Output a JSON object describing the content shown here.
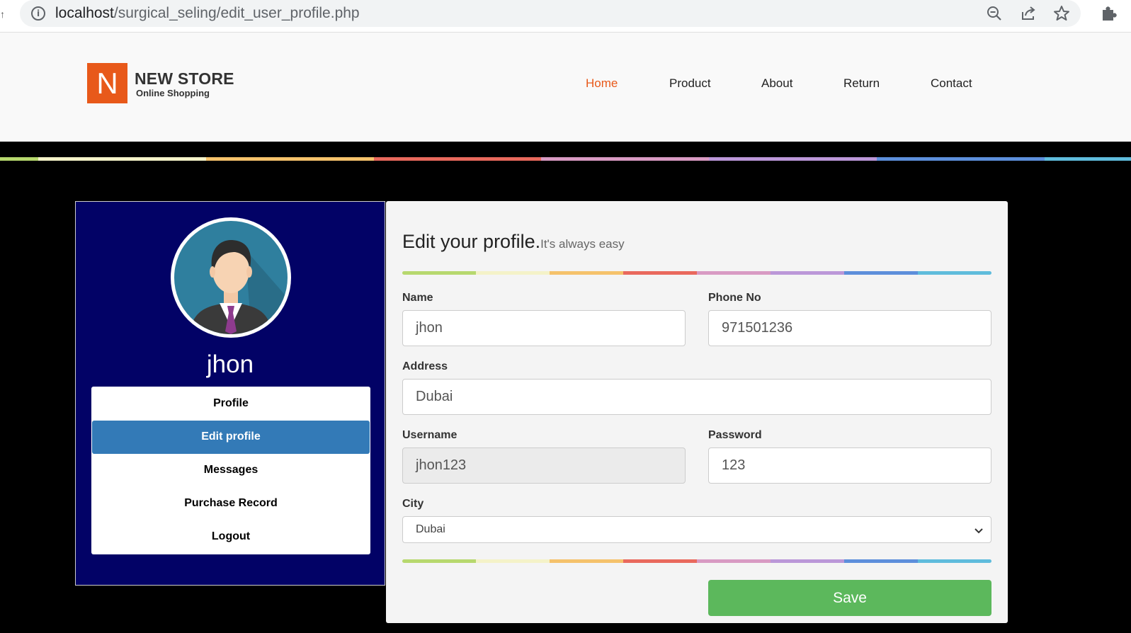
{
  "browser": {
    "url_host": "localhost",
    "url_path": "/surgical_seling/edit_user_profile.php"
  },
  "header": {
    "logo_letter": "N",
    "logo_title": "NEW STORE",
    "logo_subtitle": "Online Shopping",
    "nav": [
      {
        "label": "Home",
        "active": true
      },
      {
        "label": "Product"
      },
      {
        "label": "About"
      },
      {
        "label": "Return"
      },
      {
        "label": "Contact"
      }
    ]
  },
  "colors": {
    "brand": "#e8591a",
    "sidebar_bg": "#020266",
    "active_menu": "#337ab7",
    "save_button": "#5cb85c",
    "rainbow": [
      "#b7d86e",
      "#f4f2c8",
      "#f5c26b",
      "#e9695d",
      "#d89ac3",
      "#bb97d8",
      "#5d8fdb",
      "#5fbcdc"
    ]
  },
  "sidebar": {
    "user_name": "jhon",
    "menu": [
      {
        "label": "Profile"
      },
      {
        "label": "Edit profile",
        "active": true
      },
      {
        "label": "Messages"
      },
      {
        "label": "Purchase Record"
      },
      {
        "label": "Logout"
      }
    ]
  },
  "form": {
    "title": "Edit your profile.",
    "subtitle": "It's always easy",
    "name_label": "Name",
    "name_value": "jhon",
    "phone_label": "Phone No",
    "phone_value": "971501236",
    "address_label": "Address",
    "address_value": "Dubai",
    "username_label": "Username",
    "username_value": "jhon123",
    "password_label": "Password",
    "password_value": "123",
    "city_label": "City",
    "city_value": "Dubai",
    "save_label": "Save"
  }
}
